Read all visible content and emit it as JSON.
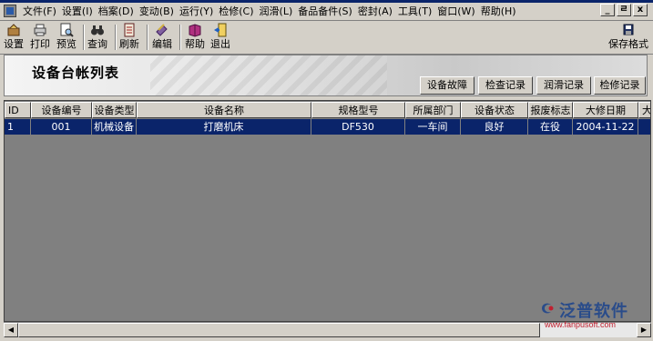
{
  "menu": [
    "文件(F)",
    "设置(I)",
    "档案(D)",
    "变动(B)",
    "运行(Y)",
    "检修(C)",
    "润滑(L)",
    "备品备件(S)",
    "密封(A)",
    "工具(T)",
    "窗口(W)",
    "帮助(H)"
  ],
  "window_buttons": [
    "_",
    "ㄹ",
    "x"
  ],
  "toolbar": {
    "settings": "设置",
    "print": "打印",
    "preview": "预览",
    "query": "查询",
    "refresh": "刷新",
    "edit": "编辑",
    "help": "帮助",
    "exit": "退出",
    "save_format": "保存格式"
  },
  "panel": {
    "title": "设备台帐列表",
    "buttons": [
      "设备故障",
      "检查记录",
      "润滑记录",
      "检修记录"
    ]
  },
  "table": {
    "headers": [
      "ID",
      "设备编号",
      "设备类型",
      "设备名称",
      "规格型号",
      "所属部门",
      "设备状态",
      "报废标志",
      "大修日期",
      "大"
    ],
    "rows": [
      [
        "1",
        "001",
        "机械设备",
        "打磨机床",
        "DF530",
        "一车间",
        "良好",
        "在役",
        "2004-11-22",
        ""
      ]
    ]
  },
  "watermark": {
    "name": "泛普软件",
    "url": "www.fanpusoft.com"
  },
  "colors": {
    "selection": "#0a246a",
    "grid_background": "#808080",
    "chrome": "#d4d0c8",
    "watermark_name": "#2a4c8a",
    "watermark_url": "#c02030"
  }
}
